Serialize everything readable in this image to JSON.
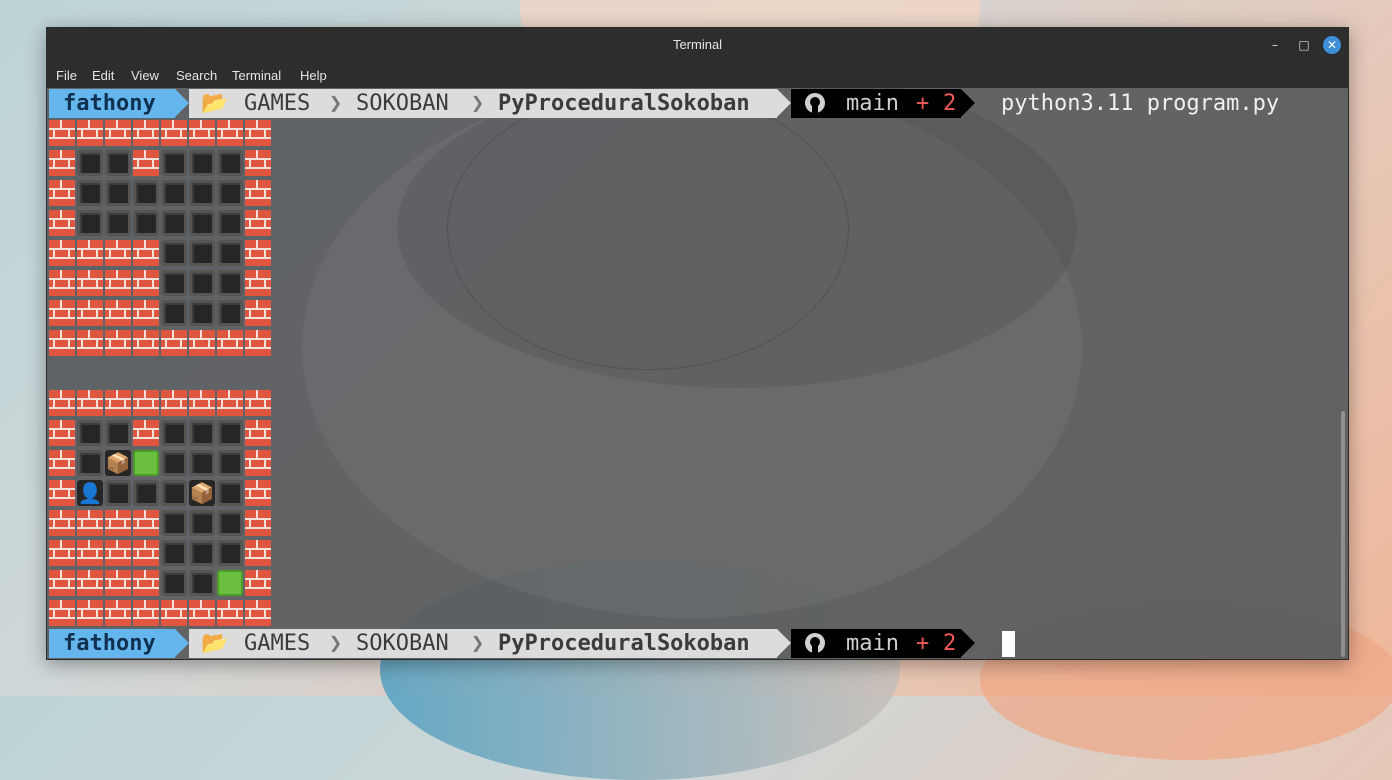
{
  "window": {
    "title": "Terminal",
    "minimize_label": "–",
    "maximize_label": "□",
    "close_label": "✕"
  },
  "menu": [
    "File",
    "Edit",
    "View",
    "Search",
    "Terminal",
    "Help"
  ],
  "prompt": {
    "user": "fathony",
    "folder_icon": "📂",
    "path": [
      "GAMES",
      "SOKOBAN",
      "PyProceduralSokoban"
    ],
    "branch": "main",
    "plus": "+",
    "changes": "2",
    "git_icon": "github-icon"
  },
  "command": "python3.11 program.py",
  "legend": {
    "W": "brick-wall",
    ".": "floor",
    "G": "goal",
    "B": "box",
    "P": "player"
  },
  "glyphs": {
    "box": "📦",
    "player": "👤"
  },
  "board1": [
    "WWWWWWWW",
    "W..W...W",
    "W......W",
    "W......W",
    "WWWW...W",
    "WWWW...W",
    "WWWW...W",
    "WWWWWWWW"
  ],
  "board2": [
    "WWWWWWWW",
    "W..W...W",
    "W.BG...W",
    "WP...B.W",
    "WWWW...W",
    "WWWW...W",
    "WWWW..GW",
    "WWWWWWWW"
  ],
  "colors": {
    "prompt_user_bg": "#66b6ee",
    "prompt_path_bg": "#dcdcdc",
    "prompt_git_bg": "#000000",
    "plus": "#f05a5a",
    "close_button": "#3d8fd8"
  }
}
